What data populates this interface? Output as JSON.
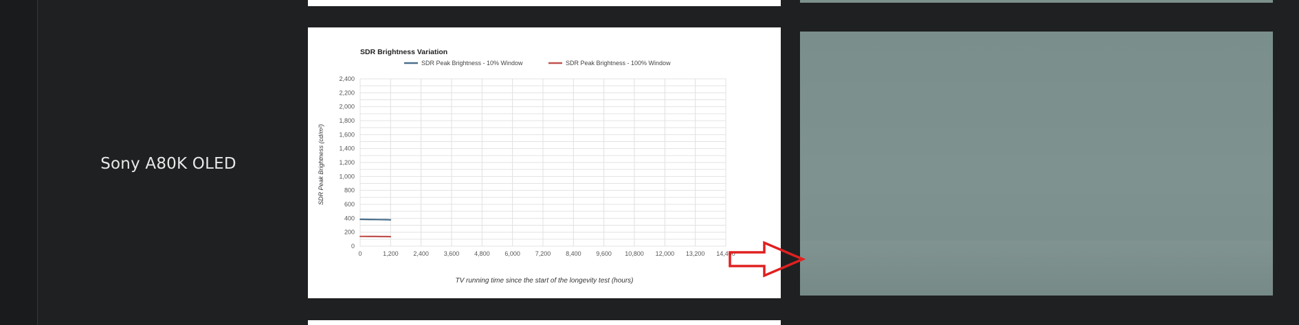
{
  "product": {
    "name": "Sony A80K OLED"
  },
  "chart_data": {
    "type": "line",
    "title": "SDR Brightness Variation",
    "ylabel": "SDR Peak Brightness (cd/m²)",
    "xlabel": "TV running time since the start of the longevity test (hours)",
    "x_ticks": [
      "0",
      "1,200",
      "2,400",
      "3,600",
      "4,800",
      "6,000",
      "7,200",
      "8,400",
      "9,600",
      "10,800",
      "12,000",
      "13,200",
      "14,400"
    ],
    "y_ticks": [
      "0",
      "200",
      "400",
      "600",
      "800",
      "1,000",
      "1,200",
      "1,400",
      "1,600",
      "1,800",
      "2,000",
      "2,200",
      "2,400"
    ],
    "xlim": [
      0,
      14400
    ],
    "ylim": [
      0,
      2400
    ],
    "grid": true,
    "legend_position": "top",
    "series": [
      {
        "name": "SDR Peak Brightness - 10% Window",
        "color": "#4a6f8c",
        "x": [
          0,
          200,
          400,
          600,
          800,
          1000,
          1200
        ],
        "y": [
          385,
          384,
          383,
          382,
          381,
          380,
          378
        ]
      },
      {
        "name": "SDR Peak Brightness - 100% Window",
        "color": "#c0504d",
        "x": [
          0,
          200,
          400,
          600,
          800,
          1000,
          1200
        ],
        "y": [
          140,
          140,
          139,
          139,
          138,
          138,
          137
        ]
      }
    ]
  },
  "arrow": {
    "color": "#e02020",
    "icon": "right-arrow-icon"
  }
}
